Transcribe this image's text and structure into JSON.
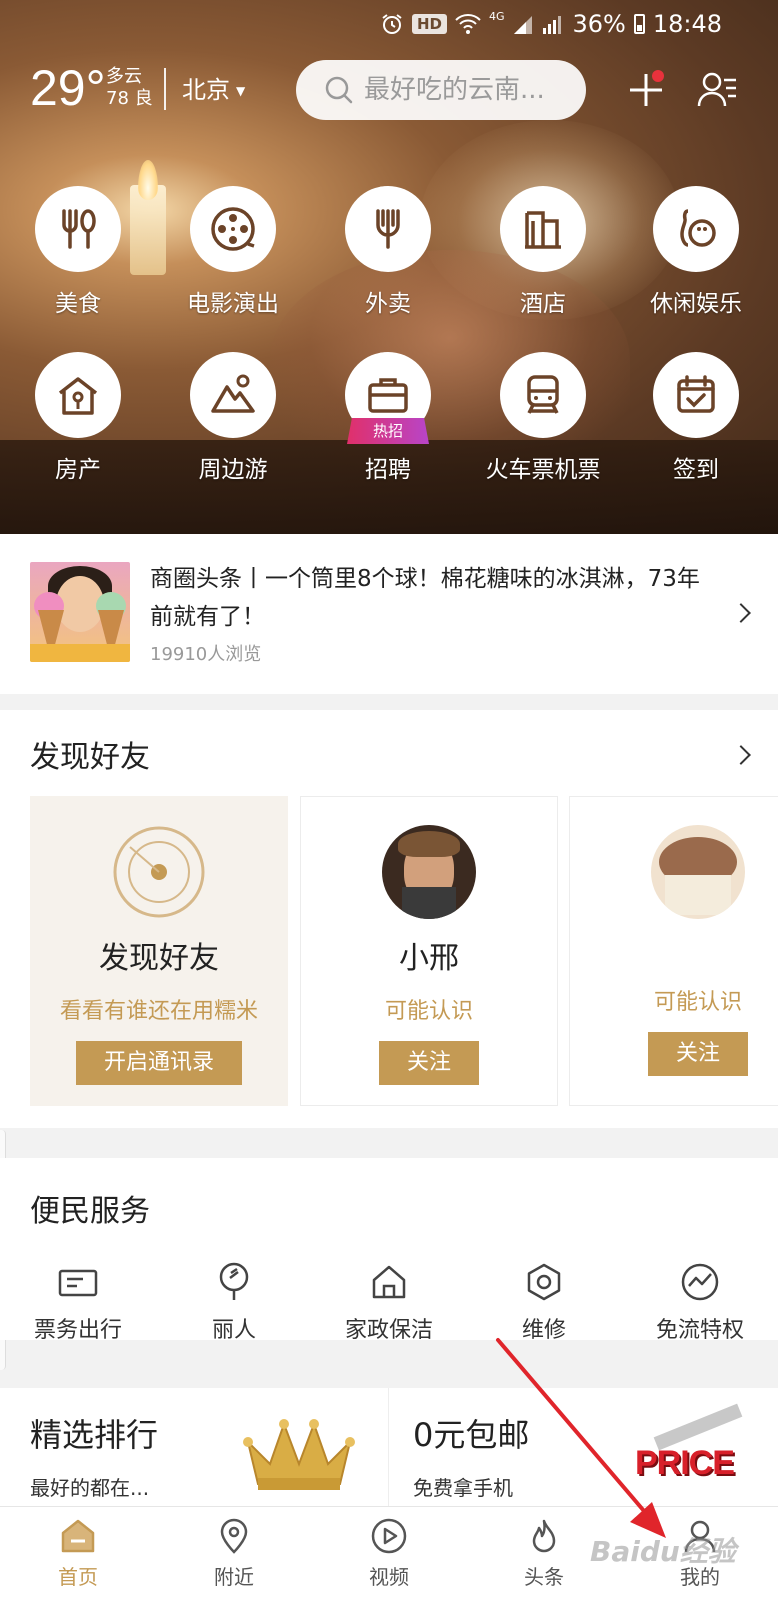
{
  "status_bar": {
    "hd": "HD",
    "network": "4G",
    "battery": "36%",
    "time": "18:48"
  },
  "header": {
    "temperature": "29°",
    "weather": "多云",
    "aqi": "78 良",
    "city": "北京",
    "search_placeholder": "最好吃的云南..."
  },
  "categories": [
    {
      "label": "美食",
      "icon": "food-icon"
    },
    {
      "label": "电影演出",
      "icon": "film-reel-icon"
    },
    {
      "label": "外卖",
      "icon": "fork-icon"
    },
    {
      "label": "酒店",
      "icon": "hotel-icon"
    },
    {
      "label": "休闲娱乐",
      "icon": "bowling-icon"
    },
    {
      "label": "房产",
      "icon": "house-icon"
    },
    {
      "label": "周边游",
      "icon": "mountain-icon"
    },
    {
      "label": "招聘",
      "icon": "briefcase-icon",
      "badge": "热招"
    },
    {
      "label": "火车票机票",
      "icon": "train-icon"
    },
    {
      "label": "签到",
      "icon": "calendar-check-icon"
    }
  ],
  "news": {
    "text": "商圈头条丨一个筒里8个球！棉花糖味的冰淇淋，73年前就有了！",
    "views": "19910人浏览"
  },
  "friends": {
    "title": "发现好友",
    "cards": [
      {
        "name": "发现好友",
        "subtitle": "看看有谁还在用糯米",
        "button": "开启通讯录"
      },
      {
        "name": "小邢",
        "subtitle": "可能认识",
        "button": "关注"
      },
      {
        "name": "",
        "subtitle": "可能认识",
        "button": "关注"
      }
    ]
  },
  "services": {
    "title": "便民服务",
    "items": [
      {
        "label": "票务出行",
        "icon": "ticket-icon"
      },
      {
        "label": "丽人",
        "icon": "mirror-icon"
      },
      {
        "label": "家政保洁",
        "icon": "home-icon"
      },
      {
        "label": "维修",
        "icon": "nut-icon"
      },
      {
        "label": "免流特权",
        "icon": "signal-wave-icon"
      }
    ]
  },
  "promos": [
    {
      "title": "精选排行",
      "subtitle": "最好的都在..."
    },
    {
      "title": "0元包邮",
      "subtitle": "免费拿手机",
      "image_text": "PRICE"
    }
  ],
  "bottom_nav": [
    {
      "label": "首页",
      "icon": "home-icon",
      "active": true
    },
    {
      "label": "附近",
      "icon": "location-pin-icon",
      "active": false
    },
    {
      "label": "视频",
      "icon": "play-icon",
      "active": false
    },
    {
      "label": "头条",
      "icon": "flame-icon",
      "active": false
    },
    {
      "label": "我的",
      "icon": "user-icon",
      "active": false
    }
  ],
  "watermark": "Baidu经验",
  "colors": {
    "accent": "#c49a54",
    "red_arrow": "#e0252b",
    "badge_red": "#e8323c"
  }
}
